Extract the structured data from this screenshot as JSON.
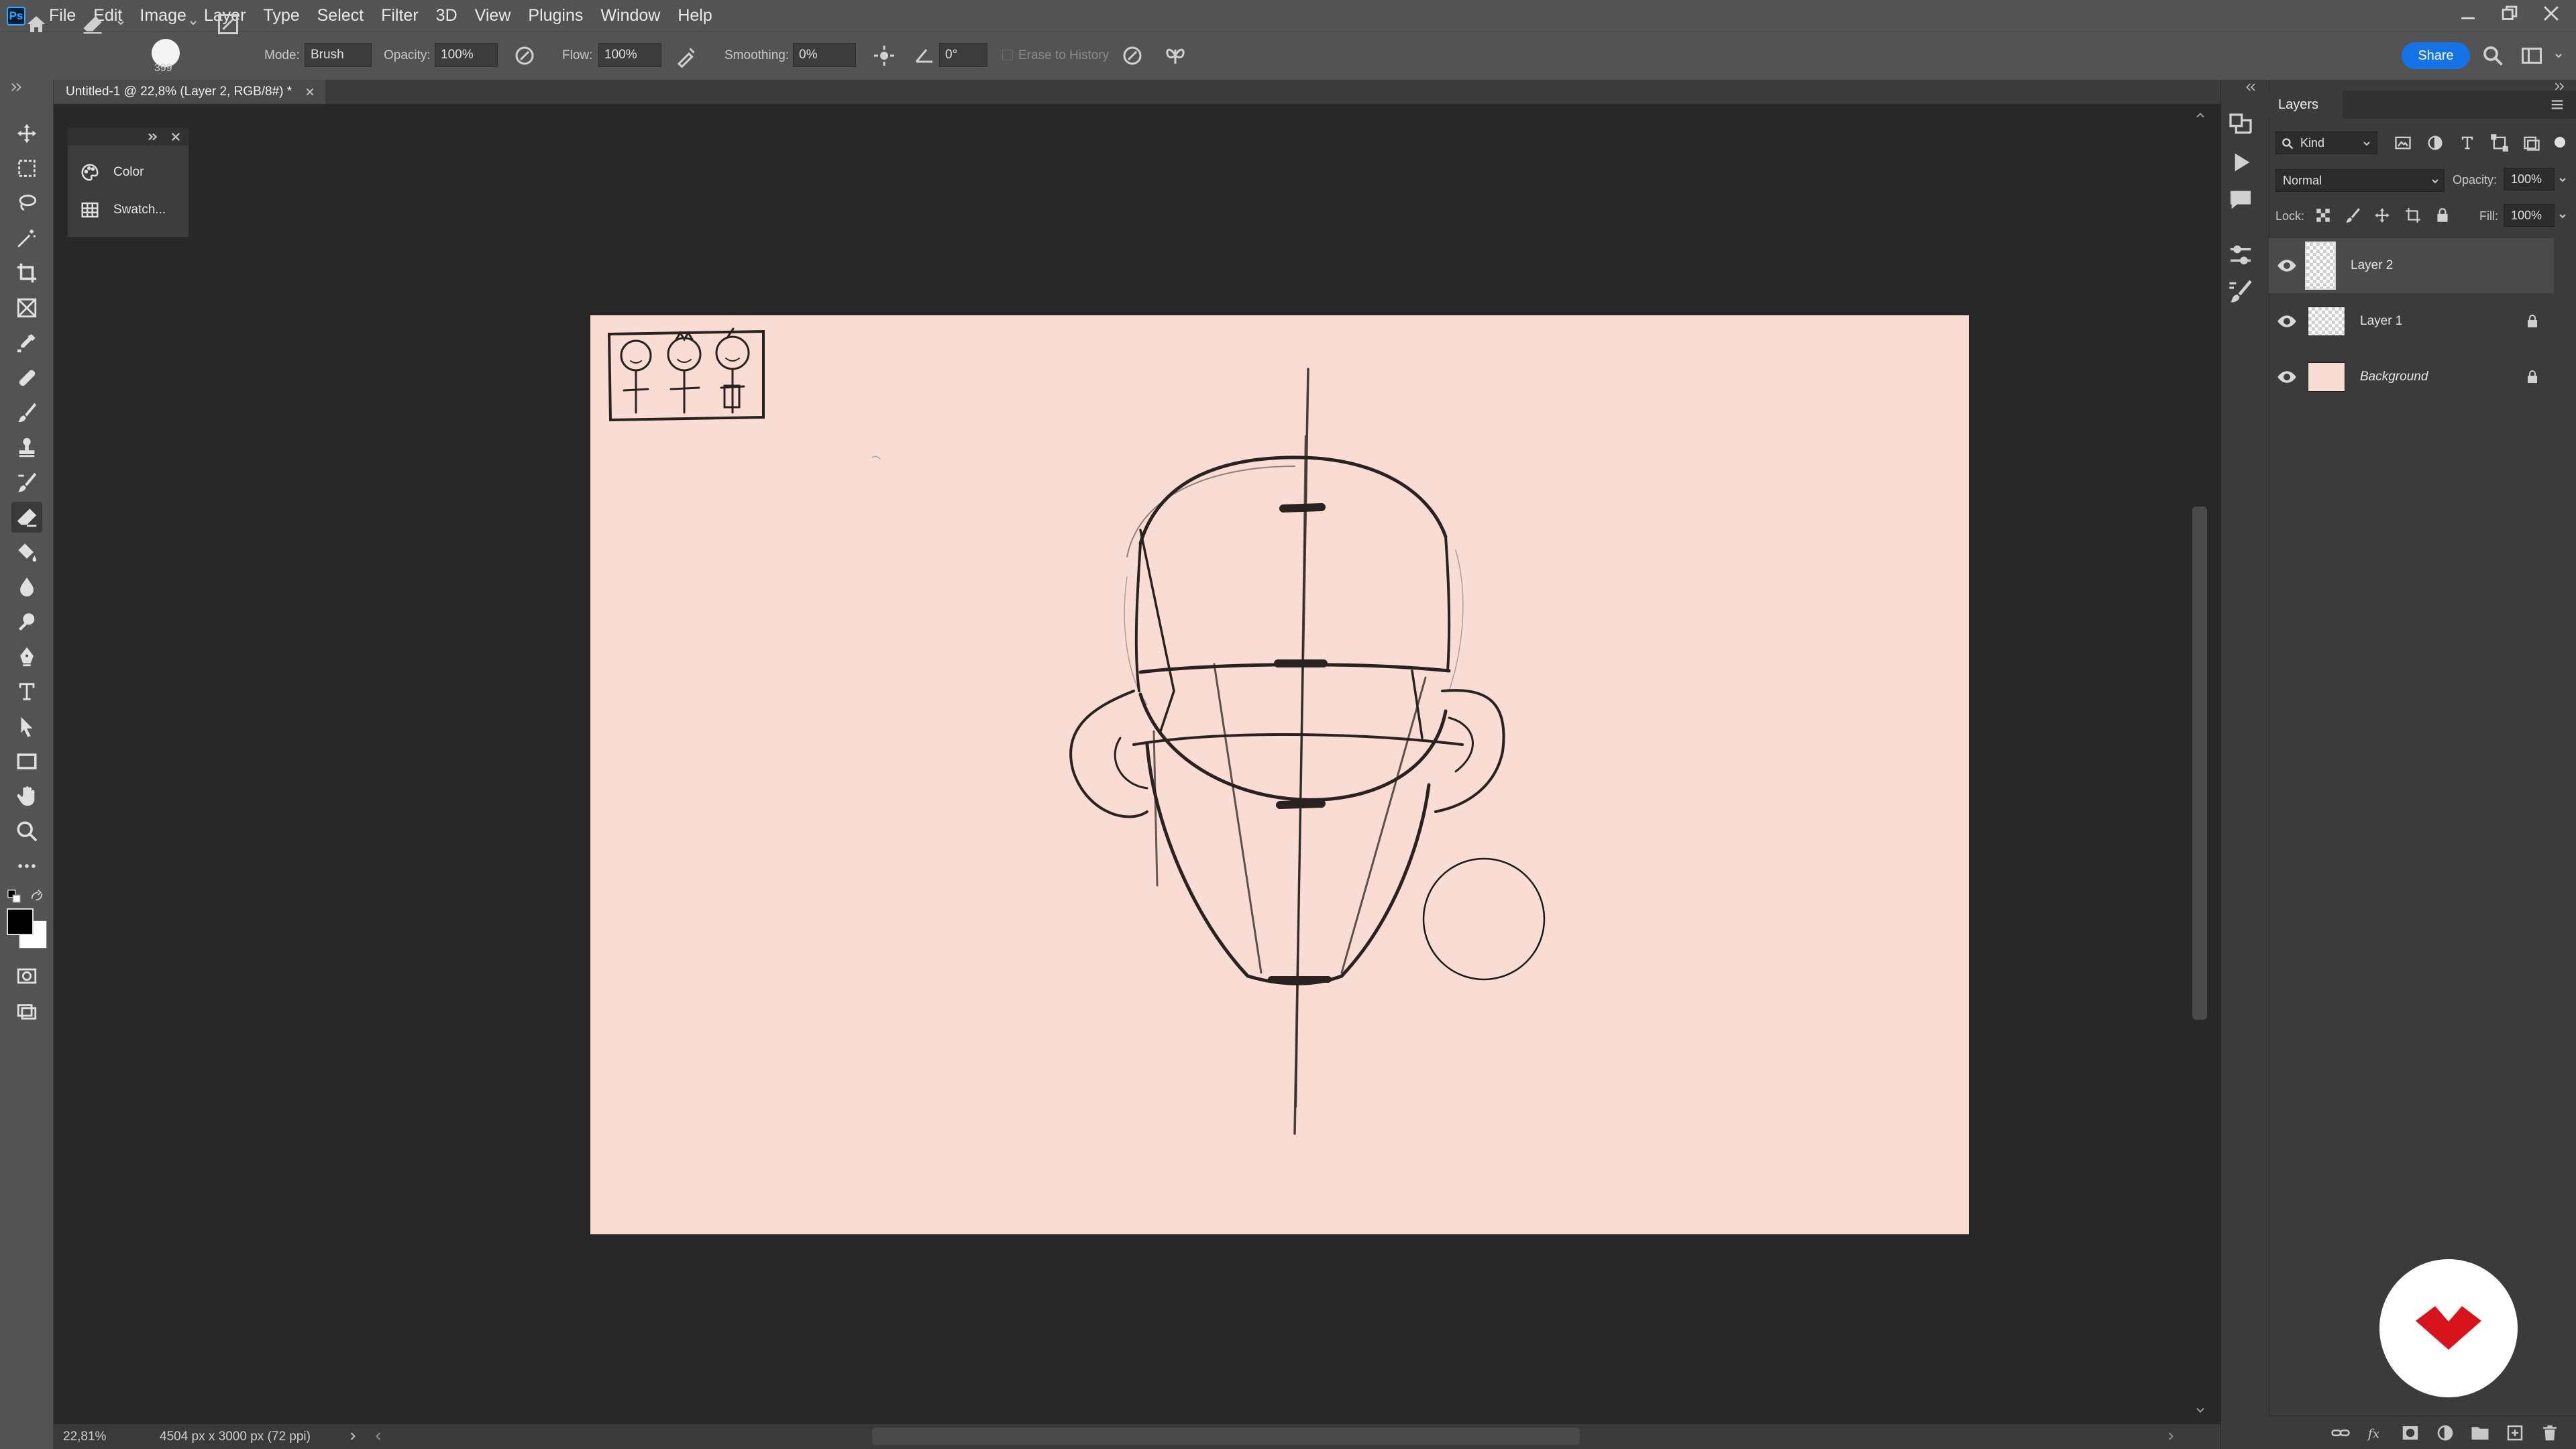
{
  "app": {
    "logo_text": "Ps"
  },
  "menu": [
    "File",
    "Edit",
    "Image",
    "Layer",
    "Type",
    "Select",
    "Filter",
    "3D",
    "View",
    "Plugins",
    "Window",
    "Help"
  ],
  "options_bar": {
    "brush_size": "399",
    "mode_label": "Mode:",
    "mode_value": "Brush",
    "opacity_label": "Opacity:",
    "opacity_value": "100%",
    "flow_label": "Flow:",
    "flow_value": "100%",
    "smoothing_label": "Smoothing:",
    "smoothing_value": "0%",
    "angle_value": "0°",
    "erase_history_label": "Erase to History",
    "share_label": "Share"
  },
  "document": {
    "tab_title": "Untitled-1 @ 22,8% (Layer 2, RGB/8#) *"
  },
  "floating_panel": {
    "items": [
      {
        "label": "Color",
        "icon": "palette-icon"
      },
      {
        "label": "Swatch...",
        "icon": "swatches-icon"
      }
    ]
  },
  "status": {
    "zoom": "22,81%",
    "doc_info": "4504 px x 3000 px (72 ppi)"
  },
  "layers_panel": {
    "title": "Layers",
    "filter_value": "Kind",
    "blend_mode": "Normal",
    "opacity_label": "Opacity:",
    "opacity_value": "100%",
    "lock_label": "Lock:",
    "fill_label": "Fill:",
    "fill_value": "100%",
    "layers": [
      {
        "name": "Layer 2",
        "selected": true,
        "locked": false,
        "italic": false
      },
      {
        "name": "Layer 1",
        "selected": false,
        "locked": true,
        "italic": false
      },
      {
        "name": "Background",
        "selected": false,
        "locked": true,
        "italic": true
      }
    ]
  },
  "colors": {
    "canvas": "#f9ddd4",
    "panel": "#3b3b3b",
    "workspace": "#282828",
    "accent": "#1473e6",
    "brand_red": "#d7141c"
  }
}
